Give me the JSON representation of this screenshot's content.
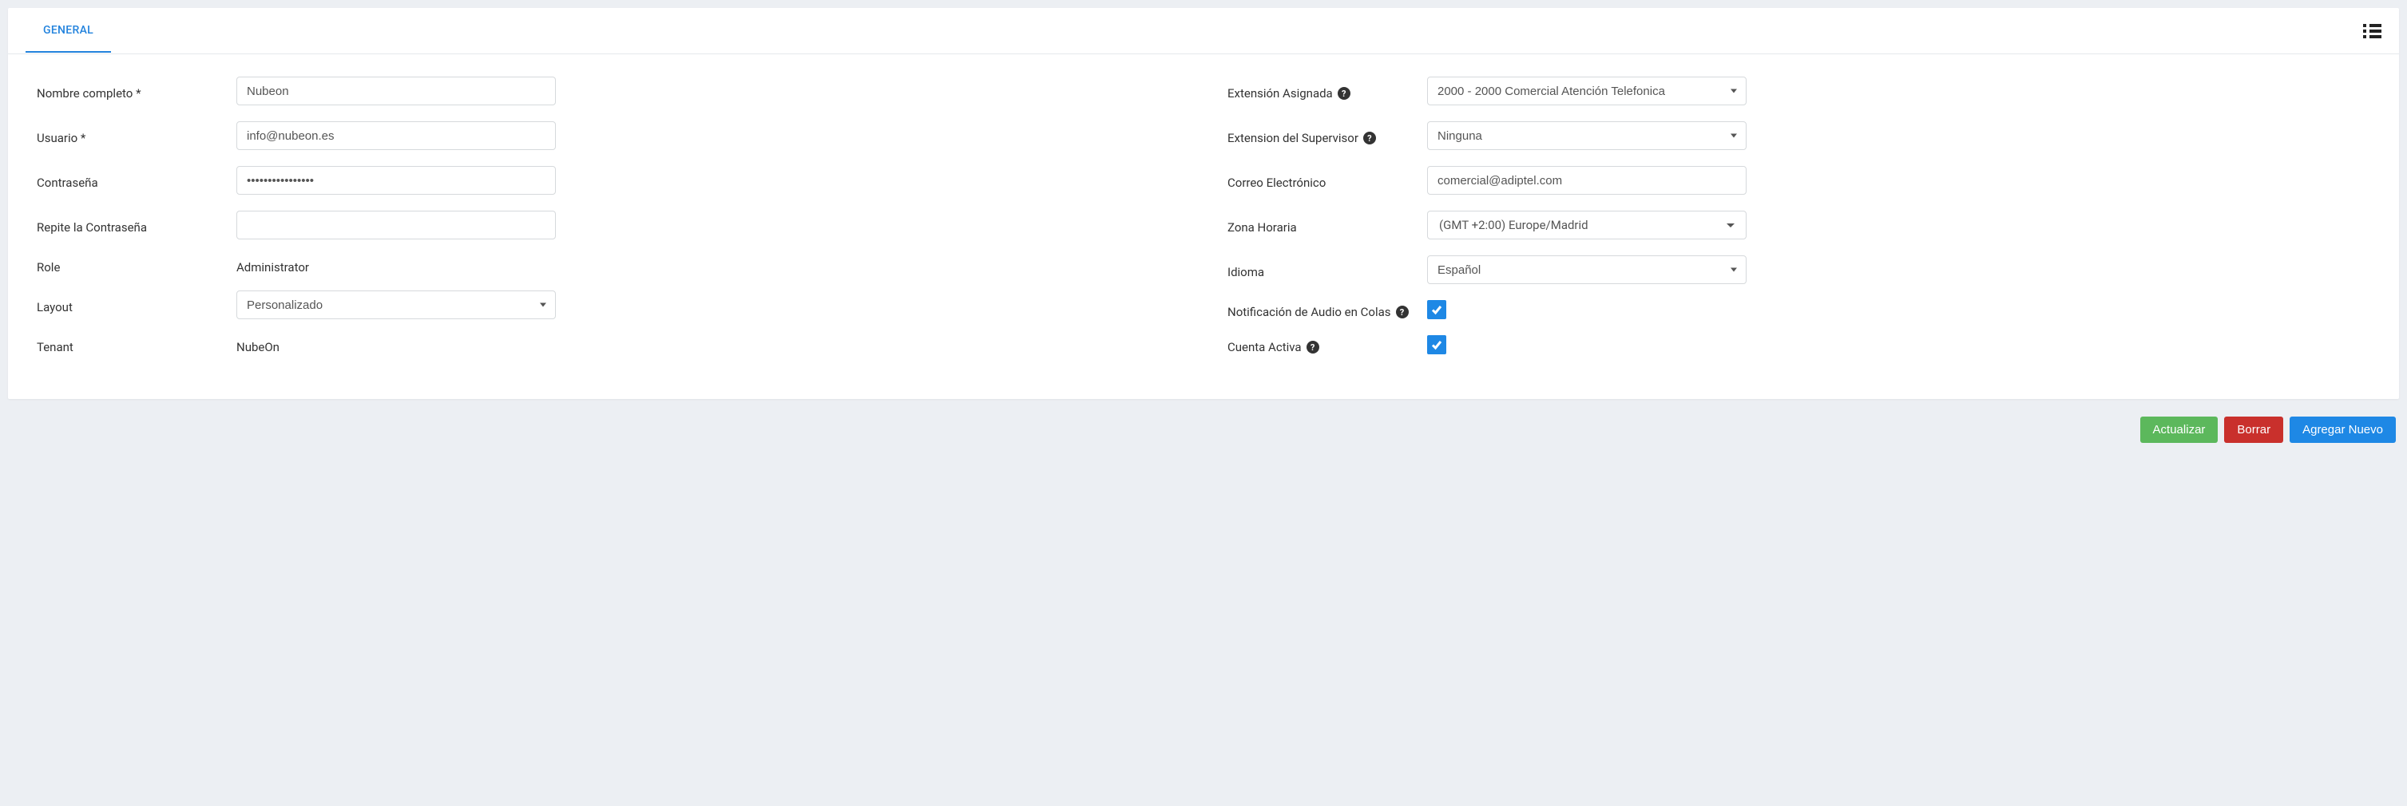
{
  "tabs": {
    "general": "GENERAL"
  },
  "left": {
    "nombre_label": "Nombre completo *",
    "nombre_value": "Nubeon",
    "usuario_label": "Usuario *",
    "usuario_value": "info@nubeon.es",
    "pwd_label": "Contraseña",
    "pwd_value": "••••••••••••••••",
    "pwd2_label": "Repite la Contraseña",
    "pwd2_value": "",
    "role_label": "Role",
    "role_value": "Administrator",
    "layout_label": "Layout",
    "layout_value": "Personalizado",
    "tenant_label": "Tenant",
    "tenant_value": "NubeOn"
  },
  "right": {
    "ext_asig_label": "Extensión Asignada",
    "ext_asig_value": "2000 - 2000 Comercial Atención Telefonica",
    "ext_sup_label": "Extension del Supervisor",
    "ext_sup_value": "Ninguna",
    "email_label": "Correo Electrónico",
    "email_value": "comercial@adiptel.com",
    "tz_label": "Zona Horaria",
    "tz_value": "(GMT +2:00) Europe/Madrid",
    "lang_label": "Idioma",
    "lang_value": "Español",
    "audio_label": "Notificación de Audio en Colas",
    "active_label": "Cuenta Activa"
  },
  "buttons": {
    "update": "Actualizar",
    "delete": "Borrar",
    "add": "Agregar Nuevo"
  }
}
